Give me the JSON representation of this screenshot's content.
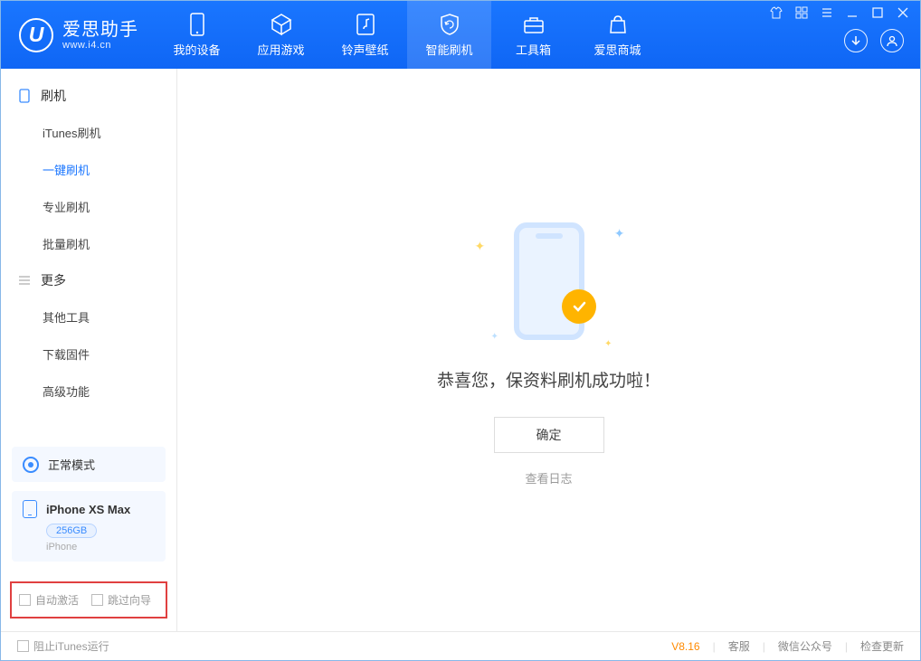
{
  "app": {
    "title": "爱思助手",
    "subtitle": "www.i4.cn",
    "logo_letter": "U"
  },
  "nav": {
    "items": [
      {
        "label": "我的设备"
      },
      {
        "label": "应用游戏"
      },
      {
        "label": "铃声壁纸"
      },
      {
        "label": "智能刷机"
      },
      {
        "label": "工具箱"
      },
      {
        "label": "爱思商城"
      }
    ],
    "active_index": 3
  },
  "sidebar": {
    "sections": [
      {
        "header": "刷机",
        "items": [
          "iTunes刷机",
          "一键刷机",
          "专业刷机",
          "批量刷机"
        ],
        "active_index": 1
      },
      {
        "header": "更多",
        "items": [
          "其他工具",
          "下载固件",
          "高级功能"
        ],
        "active_index": -1
      }
    ],
    "device_mode": "正常模式",
    "device_name": "iPhone XS Max",
    "device_capacity": "256GB",
    "device_type": "iPhone",
    "checks": {
      "auto_activate": "自动激活",
      "skip_wizard": "跳过向导"
    }
  },
  "main": {
    "success_message": "恭喜您，保资料刷机成功啦！",
    "ok_button": "确定",
    "view_log": "查看日志"
  },
  "footer": {
    "block_itunes": "阻止iTunes运行",
    "version": "V8.16",
    "links": [
      "客服",
      "微信公众号",
      "检查更新"
    ]
  }
}
